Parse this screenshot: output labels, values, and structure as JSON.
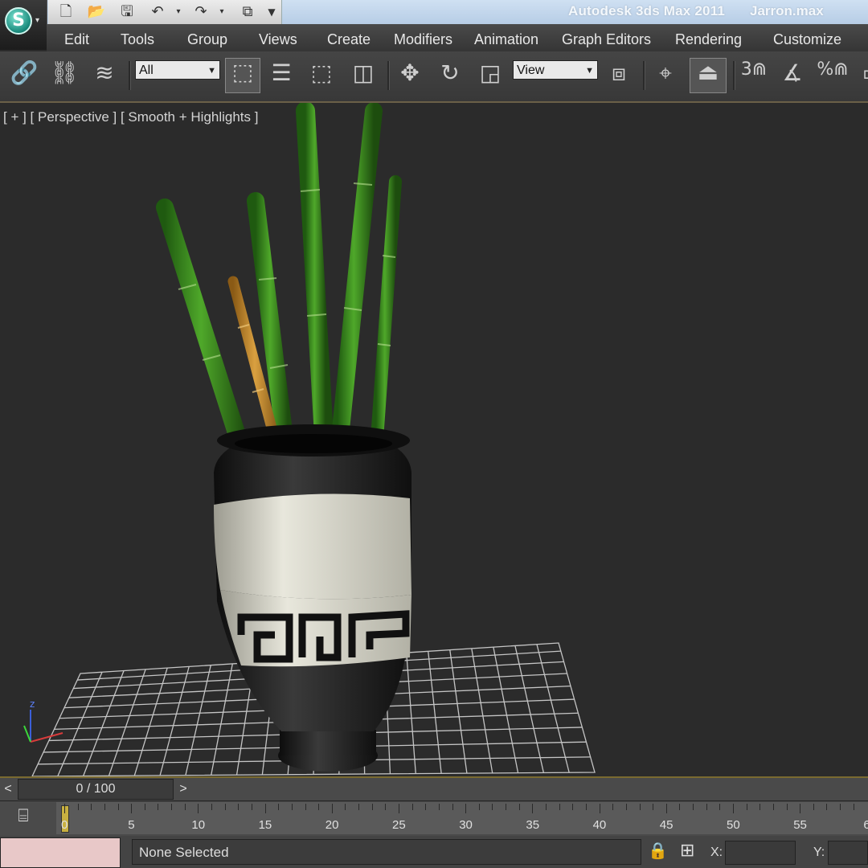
{
  "titlebar": {
    "app_title": "Autodesk 3ds Max  2011",
    "file_name": "Jarron.max"
  },
  "menu": {
    "items": [
      "Edit",
      "Tools",
      "Group",
      "Views",
      "Create",
      "Modifiers",
      "Animation",
      "Graph Editors",
      "Rendering",
      "Customize"
    ]
  },
  "toolbar": {
    "selection_filter": "All",
    "reference_coord": "View",
    "snap_3d": "3",
    "percent_snap": "%"
  },
  "viewport": {
    "label": "[ + ] [ Perspective ] [ Smooth + Highlights ]",
    "axis_z": "z",
    "axis_y": "y"
  },
  "timeline": {
    "frame_display": "0 / 100",
    "prev": "<",
    "next": ">",
    "ticks": [
      "0",
      "5",
      "10",
      "15",
      "20",
      "25",
      "30",
      "35",
      "40",
      "45",
      "50",
      "55",
      "6"
    ]
  },
  "status": {
    "selection": "None Selected",
    "x_label": "X:",
    "y_label": "Y:"
  },
  "colors": {
    "bamboo_green": "#3c8a1e",
    "bamboo_tan": "#c8902e",
    "vase_cream": "#d9d8cc",
    "vase_black": "#1a1a1a",
    "viewport_bg": "#2b2b2b"
  }
}
